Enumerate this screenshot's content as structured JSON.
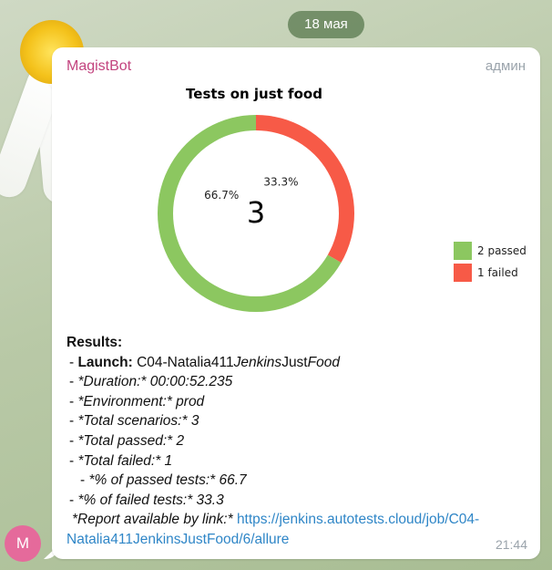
{
  "date_label": "18 мая",
  "avatar_letter": "M",
  "message": {
    "sender": "MagistBot",
    "role": "админ",
    "time": "21:44",
    "results_heading": "Results:",
    "launch_label": "Launch:",
    "launch_prefix": "C04-Natalia411",
    "launch_mid": "Jenkins",
    "launch_mid2": "Just",
    "launch_suffix": "Food",
    "duration": "*Duration:* 00:00:52.235",
    "environment": "*Environment:* prod",
    "total_scenarios": "*Total scenarios:* 3",
    "total_passed": "*Total passed:* 2",
    "total_failed": "*Total failed:* 1",
    "passed_pct": "*% of passed tests:* 66.7",
    "failed_pct": "*% of failed tests:* 33.3",
    "report_text": "*Report available by link:*",
    "report_link_1": "https://jenkins.autotests.cloud/job/C04-",
    "report_link_2": "Natalia411JenkinsJustFood/6/allure"
  },
  "colors": {
    "passed": "#8cc760",
    "failed": "#f75a47",
    "link": "#2f86c7",
    "sender": "#c3447f"
  },
  "chart_data": {
    "type": "pie",
    "title": "Tests on just food",
    "center_label": "3",
    "slices": [
      {
        "label": "2 passed",
        "value": 2,
        "percent_label": "66.7%",
        "color": "#8cc760"
      },
      {
        "label": "1 failed",
        "value": 1,
        "percent_label": "33.3%",
        "color": "#f75a47"
      }
    ],
    "legend_position": "right"
  }
}
